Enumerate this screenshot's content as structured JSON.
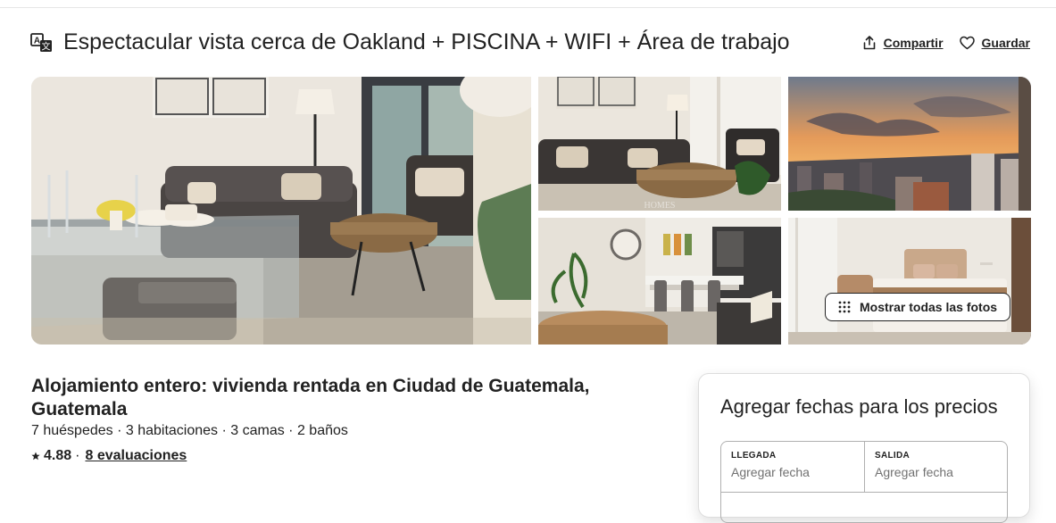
{
  "listing": {
    "title": "Espectacular vista cerca de Oakland + PISCINA + WIFI + Área de trabajo",
    "translate_icon": "translate-icon",
    "actions": {
      "share_label": "Compartir",
      "share_icon": "share-icon",
      "save_label": "Guardar",
      "save_icon": "heart-icon"
    }
  },
  "gallery": {
    "show_all_label": "Mostrar todas las fotos",
    "show_all_icon": "grid-dots-icon",
    "photos": [
      {
        "subject": "living-dining-room"
      },
      {
        "subject": "living-room-sofa"
      },
      {
        "subject": "city-sunset-view"
      },
      {
        "subject": "dining-kitchen"
      },
      {
        "subject": "bedroom"
      }
    ]
  },
  "summary": {
    "heading": "Alojamiento entero: vivienda rentada en Ciudad de Guatemala, Guatemala",
    "details": "7 huéspedes · 3 habitaciones · 3 camas · 2 baños",
    "star_icon": "star-icon",
    "rating": "4.88",
    "separator": "·",
    "reviews": "8 evaluaciones"
  },
  "booking": {
    "title": "Agregar fechas para los precios",
    "checkin_label": "LLEGADA",
    "checkin_placeholder": "Agregar fecha",
    "checkout_label": "SALIDA",
    "checkout_placeholder": "Agregar fecha"
  },
  "colors": {
    "text": "#222222",
    "muted": "#717171",
    "border": "#b0b0b0"
  }
}
